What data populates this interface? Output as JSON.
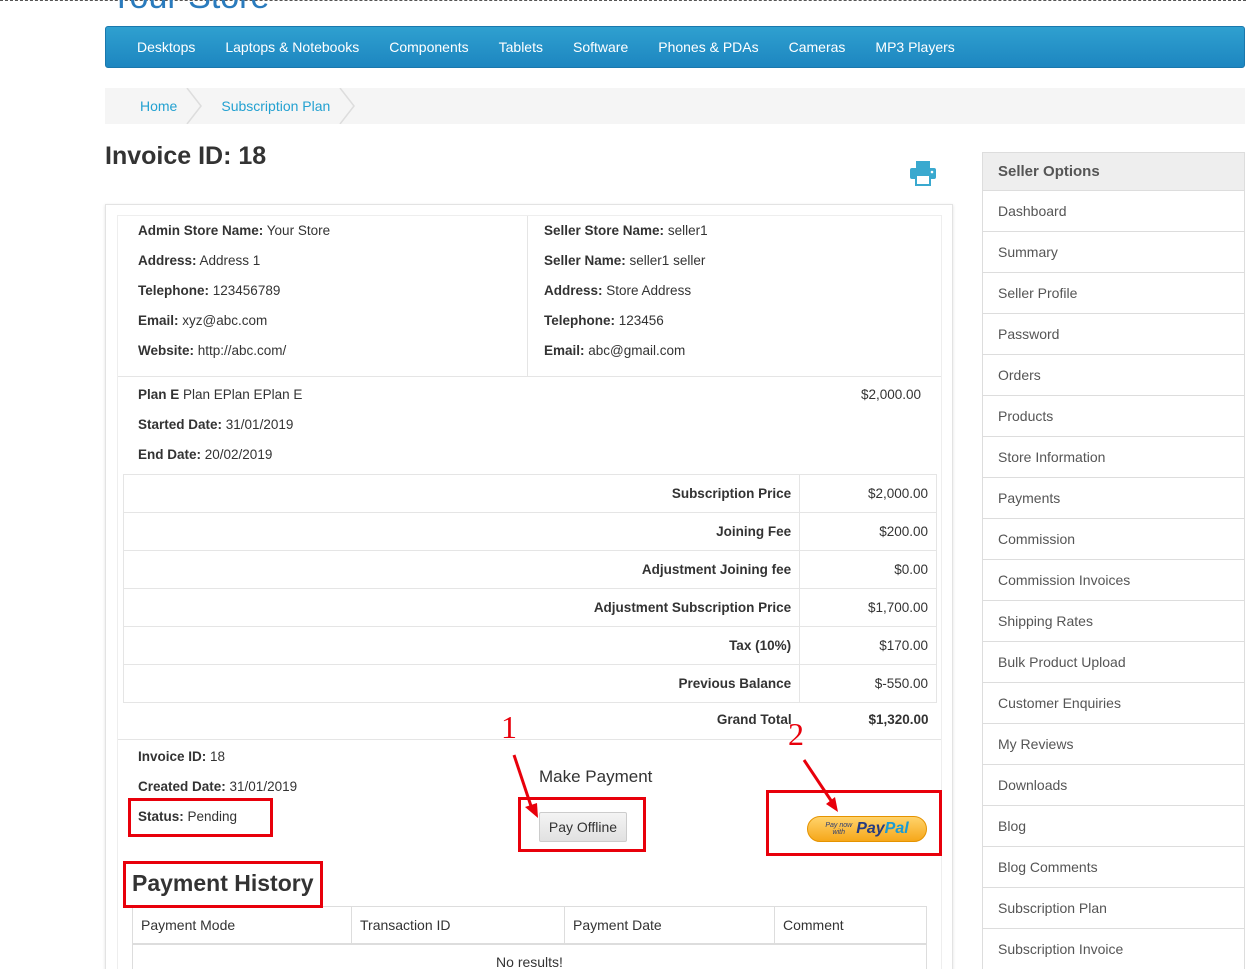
{
  "store": {
    "title": "Your Store"
  },
  "menu": [
    "Desktops",
    "Laptops & Notebooks",
    "Components",
    "Tablets",
    "Software",
    "Phones & PDAs",
    "Cameras",
    "MP3 Players"
  ],
  "breadcrumb": [
    "Home",
    "Subscription Plan"
  ],
  "invoice": {
    "title": "Invoice ID: 18",
    "admin": [
      {
        "label": "Admin Store Name:",
        "value": " Your Store"
      },
      {
        "label": "Address:",
        "value": " Address 1"
      },
      {
        "label": "Telephone:",
        "value": " 123456789"
      },
      {
        "label": "Email:",
        "value": " xyz@abc.com"
      },
      {
        "label": "Website:",
        "value": " http://abc.com/"
      }
    ],
    "seller": [
      {
        "label": "Seller Store Name:",
        "value": " seller1"
      },
      {
        "label": "Seller Name:",
        "value": " seller1 seller"
      },
      {
        "label": "Address:",
        "value": " Store Address"
      },
      {
        "label": "Telephone:",
        "value": " 123456"
      },
      {
        "label": "Email:",
        "value": " abc@gmail.com"
      }
    ],
    "plan": {
      "name_label": "Plan E",
      "name_value": " Plan EPlan EPlan E",
      "amount": "$2,000.00",
      "started_label": "Started Date:",
      "started_value": " 31/01/2019",
      "end_label": "End Date:",
      "end_value": " 20/02/2019"
    },
    "totals": [
      {
        "label": "Subscription Price",
        "value": "$2,000.00"
      },
      {
        "label": "Joining Fee",
        "value": "$200.00"
      },
      {
        "label": "Adjustment Joining fee",
        "value": "$0.00"
      },
      {
        "label": "Adjustment Subscription Price",
        "value": "$1,700.00"
      },
      {
        "label": "Tax (10%)",
        "value": "$170.00"
      },
      {
        "label": "Previous Balance",
        "value": "$-550.00"
      }
    ],
    "grand_total": {
      "label": "Grand Total",
      "value": "$1,320.00"
    },
    "meta": [
      {
        "label": "Invoice ID:",
        "value": " 18"
      },
      {
        "label": "Created Date:",
        "value": " 31/01/2019"
      },
      {
        "label": "Status:",
        "value": " Pending"
      }
    ],
    "make_payment": "Make Payment",
    "pay_offline": "Pay Offline",
    "paypal": {
      "small_line1": "Pay now",
      "small_line2": "with",
      "brand_pay": "Pay",
      "brand_pal": "Pal"
    }
  },
  "history": {
    "title": "Payment History",
    "columns": [
      "Payment Mode",
      "Transaction ID",
      "Payment Date",
      "Comment"
    ],
    "empty": "No results!"
  },
  "annotations": {
    "one": "1",
    "two": "2"
  },
  "sidebar": {
    "title": "Seller Options",
    "items": [
      "Dashboard",
      "Summary",
      "Seller Profile",
      "Password",
      "Orders",
      "Products",
      "Store Information",
      "Payments",
      "Commission",
      "Commission Invoices",
      "Shipping Rates",
      "Bulk Product Upload",
      "Customer Enquiries",
      "My Reviews",
      "Downloads",
      "Blog",
      "Blog Comments",
      "Subscription Plan",
      "Subscription Invoice"
    ]
  },
  "colors": {
    "menu": "#1d86c0",
    "link": "#23a1d1",
    "annotation": "#e8000b",
    "print_icon": "#3aa9cf"
  }
}
